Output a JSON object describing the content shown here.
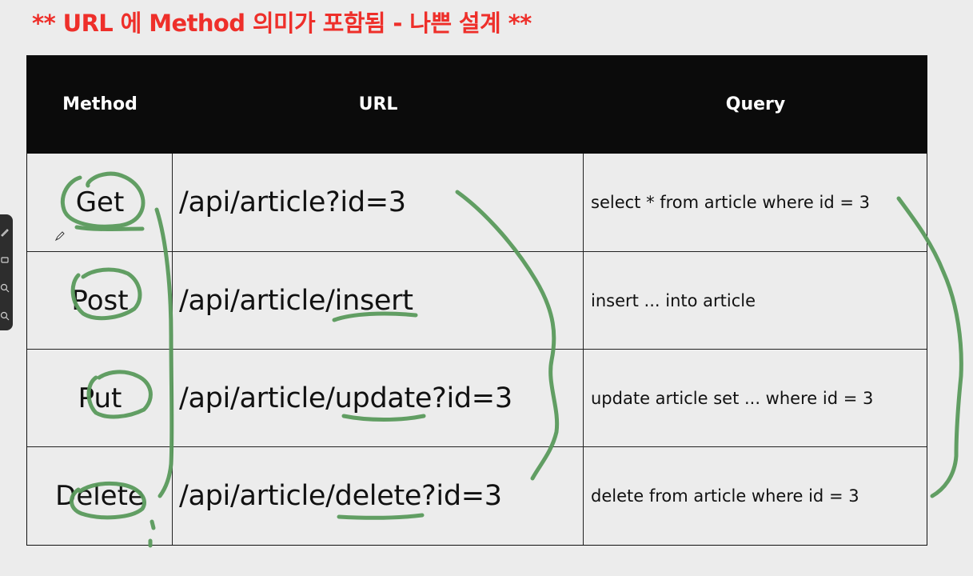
{
  "title": "** URL 에 Method 의미가 포함됨 - 나쁜 설계 **",
  "table": {
    "headers": [
      "Method",
      "URL",
      "Query"
    ],
    "rows": [
      {
        "method": "Get",
        "url": "/api/article?id=3",
        "query": "select * from article where id = 3"
      },
      {
        "method": "Post",
        "url": "/api/article/insert",
        "query": "insert ... into article"
      },
      {
        "method": "Put",
        "url": "/api/article/update?id=3",
        "query": "update article set ... where id = 3"
      },
      {
        "method": "Delete",
        "url": "/api/article/delete?id=3",
        "query": "delete from article where id = 3"
      }
    ]
  },
  "colors": {
    "title": "#ee2f2a",
    "header_bg": "#0b0b0b",
    "page_bg": "#ececec",
    "annotation_ink": "#5a9a5c"
  },
  "annotation_tools": {
    "icons": [
      "pen-icon",
      "eraser-icon",
      "zoom-in-icon",
      "zoom-out-icon"
    ]
  }
}
